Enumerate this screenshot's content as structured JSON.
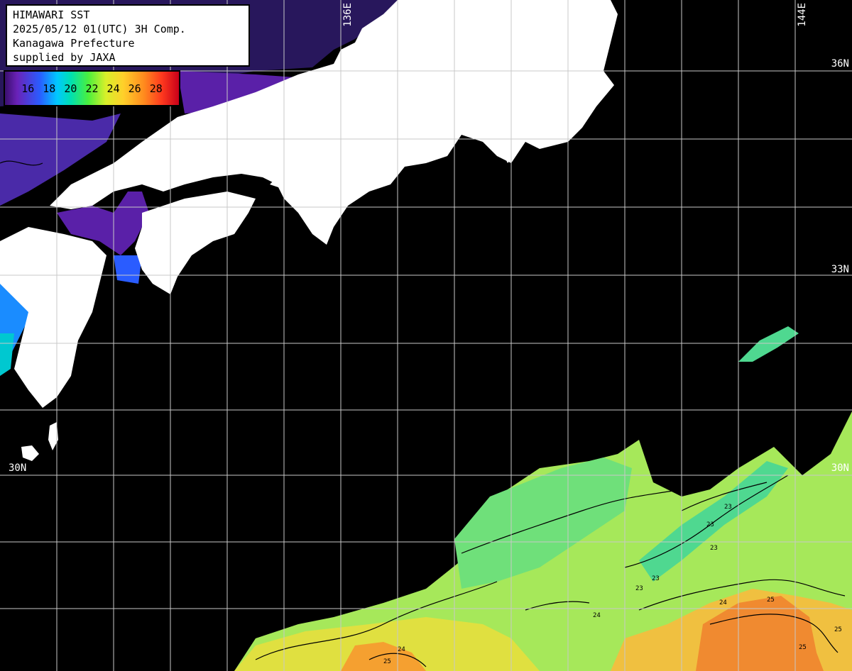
{
  "header": {
    "line1": "HIMAWARI SST",
    "line2": "2025/05/12 01(UTC) 3H Comp.",
    "line3": "Kanagawa Prefecture",
    "line4": "supplied by JAXA"
  },
  "legend": {
    "labels": "16 18 20 22 24 26 28"
  },
  "grid_labels": {
    "lon_136": "136E",
    "lon_144": "144E",
    "lat_36": "36N",
    "lat_33": "33N",
    "lat_30_left": "30N",
    "lat_30_right": "30N"
  },
  "contour_labels": [
    "23",
    "23",
    "23",
    "23",
    "23",
    "24",
    "24",
    "24",
    "25",
    "25",
    "25",
    "25"
  ],
  "colors": {
    "sea_no_data": "#000000",
    "land": "#ffffff",
    "grid": "#c8c8c8",
    "sst_cool": "#6a22b8",
    "sst_mid": "#7be05a",
    "sst_warm": "#f0b040"
  }
}
